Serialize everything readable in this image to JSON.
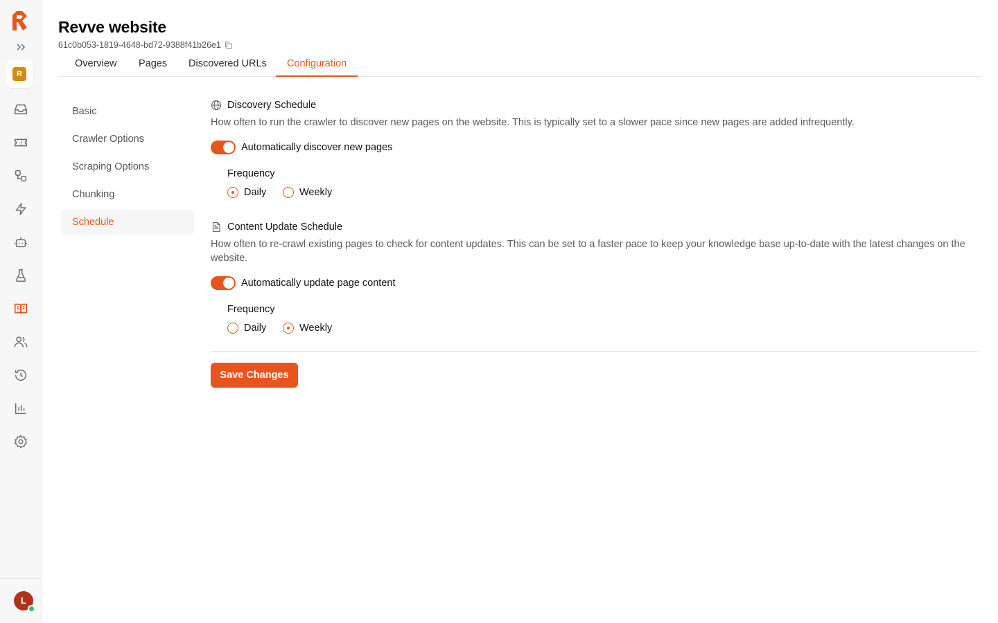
{
  "app": {
    "workspace_initial": "R",
    "user_initial": "L",
    "colors": {
      "accent": "#e8551c",
      "workspace": "#d28a12",
      "avatar": "#b0321a",
      "presence": "#22c55e"
    }
  },
  "rail": {
    "icons": [
      "logo-icon",
      "expand-sidebar-icon",
      "inbox-icon",
      "ticket-icon",
      "workflow-icon",
      "lightning-icon",
      "bot-icon",
      "flask-icon",
      "book-open-icon",
      "users-icon",
      "history-icon",
      "bar-chart-icon",
      "gear-icon"
    ]
  },
  "header": {
    "title": "Revve website",
    "uuid": "61c0b053-1819-4648-bd72-9388f41b26e1"
  },
  "tabs": [
    {
      "label": "Overview",
      "active": false
    },
    {
      "label": "Pages",
      "active": false
    },
    {
      "label": "Discovered URLs",
      "active": false
    },
    {
      "label": "Configuration",
      "active": true
    }
  ],
  "side_menu": [
    {
      "label": "Basic",
      "active": false
    },
    {
      "label": "Crawler Options",
      "active": false
    },
    {
      "label": "Scraping Options",
      "active": false
    },
    {
      "label": "Chunking",
      "active": false
    },
    {
      "label": "Schedule",
      "active": true
    }
  ],
  "discovery": {
    "title": "Discovery Schedule",
    "description": "How often to run the crawler to discover new pages on the website. This is typically set to a slower pace since new pages are added infrequently.",
    "toggle_label": "Automatically discover new pages",
    "toggle_on": true,
    "frequency_label": "Frequency",
    "options": [
      "Daily",
      "Weekly"
    ],
    "selected": "Daily"
  },
  "content_update": {
    "title": "Content Update Schedule",
    "description": "How often to re-crawl existing pages to check for content updates. This can be set to a faster pace to keep your knowledge base up-to-date with the latest changes on the website.",
    "toggle_label": "Automatically update page content",
    "toggle_on": true,
    "frequency_label": "Frequency",
    "options": [
      "Daily",
      "Weekly"
    ],
    "selected": "Weekly"
  },
  "actions": {
    "save_label": "Save Changes"
  }
}
